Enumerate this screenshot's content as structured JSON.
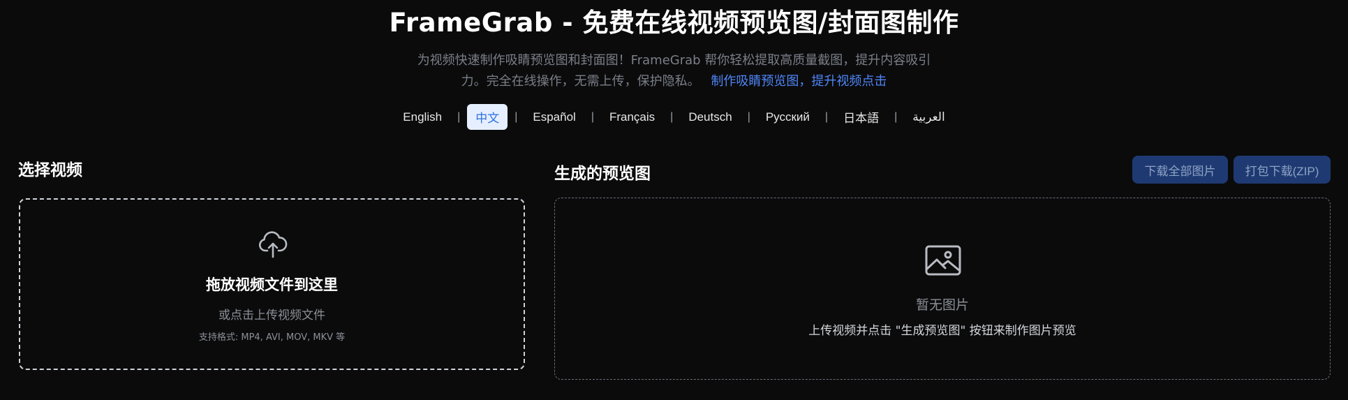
{
  "header": {
    "title": "FrameGrab - 免费在线视频预览图/封面图制作",
    "subtitle_line1": "为视频快速制作吸睛预览图和封面图！FrameGrab 帮你轻松提取高质量截图，提升内容吸引",
    "subtitle_line2": "力。完全在线操作，无需上传，保护隐私。",
    "cta": "制作吸睛预览图，提升视频点击"
  },
  "languages": [
    {
      "label": "English",
      "active": false
    },
    {
      "label": "中文",
      "active": true
    },
    {
      "label": "Español",
      "active": false
    },
    {
      "label": "Français",
      "active": false
    },
    {
      "label": "Deutsch",
      "active": false
    },
    {
      "label": "Русский",
      "active": false
    },
    {
      "label": "日本語",
      "active": false
    },
    {
      "label": "العربية",
      "active": false
    }
  ],
  "separator": "|",
  "left_panel": {
    "title": "选择视频",
    "dropzone_title": "拖放视频文件到这里",
    "dropzone_sub": "或点击上传视频文件",
    "formats": "支持格式: MP4, AVI, MOV, MKV 等",
    "icon": "cloud-upload-icon"
  },
  "right_panel": {
    "title": "生成的预览图",
    "download_all": "下载全部图片",
    "download_zip": "打包下载(ZIP)",
    "empty_title": "暂无图片",
    "empty_sub": "上传视频并点击 \"生成预览图\" 按钮来制作图片预览",
    "icon": "image-icon"
  },
  "colors": {
    "background": "#0b0b0c",
    "accent": "#4f86f7",
    "button_bg": "#1f3a72",
    "active_lang_bg": "#e6efff"
  }
}
